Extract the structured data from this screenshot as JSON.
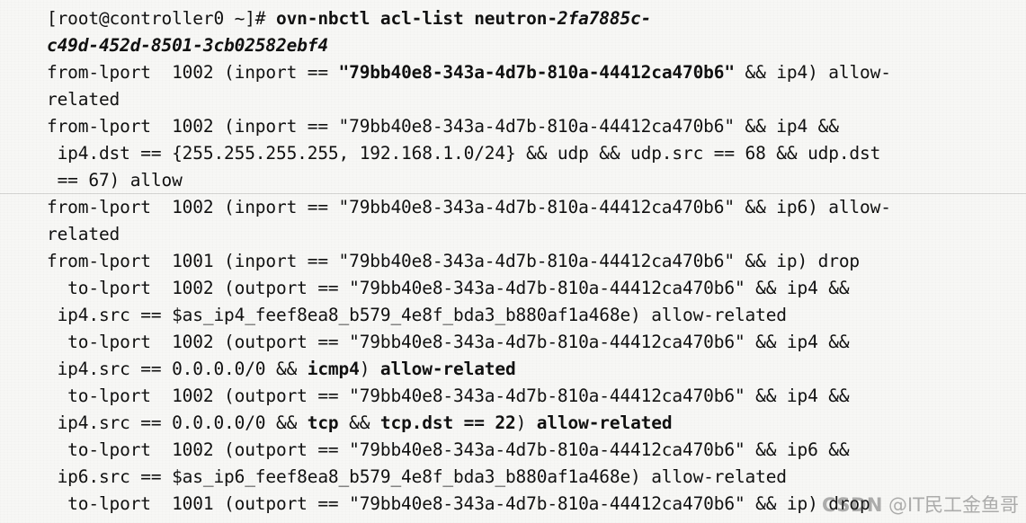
{
  "terminal": {
    "background_color": "#f7f7f5",
    "text_color": "#111111",
    "prompt": "[root@controller0 ~]# ",
    "command": "ovn-nbctl acl-list neutron-",
    "command_argument_line1": "2fa7885c-",
    "command_argument_line2": "c49d-452d-8501-3cb02582ebf4",
    "lines": [
      {
        "id": "line-prompt-command",
        "segments": [
          {
            "text": "[root@controller0 ~]# ",
            "style": "regular"
          },
          {
            "text": "ovn-nbctl acl-list neutron-",
            "style": "bold"
          },
          {
            "text": "2fa7885c-",
            "style": "bolditalic"
          }
        ]
      },
      {
        "id": "line-command-wrap",
        "segments": [
          {
            "text": "c49d-452d-8501-3cb02582ebf4",
            "style": "bolditalic"
          }
        ]
      },
      {
        "id": "line-acl-1a",
        "segments": [
          {
            "text": "from-lport  1002 (inport == ",
            "style": "regular"
          },
          {
            "text": "\"79bb40e8-343a-4d7b-810a-44412ca470b6\"",
            "style": "bold"
          },
          {
            "text": " && ip4) allow-",
            "style": "regular"
          }
        ]
      },
      {
        "id": "line-acl-1b",
        "segments": [
          {
            "text": "related",
            "style": "regular"
          }
        ]
      },
      {
        "id": "line-acl-2a",
        "segments": [
          {
            "text": "from-lport  1002 (inport == \"79bb40e8-343a-4d7b-810a-44412ca470b6\" && ip4 &&",
            "style": "regular"
          }
        ]
      },
      {
        "id": "line-acl-2b",
        "segments": [
          {
            "text": " ip4.dst == {255.255.255.255, 192.168.1.0/24} && udp && udp.src == 68 && udp.dst",
            "style": "regular"
          }
        ]
      },
      {
        "id": "line-acl-2c",
        "segments": [
          {
            "text": " == 67) allow",
            "style": "regular"
          }
        ]
      },
      {
        "id": "line-acl-3a",
        "segments": [
          {
            "text": "from-lport  1002 (inport == \"79bb40e8-343a-4d7b-810a-44412ca470b6\" && ip6) allow-",
            "style": "regular"
          }
        ]
      },
      {
        "id": "line-acl-3b",
        "segments": [
          {
            "text": "related",
            "style": "regular"
          }
        ]
      },
      {
        "id": "line-acl-4",
        "segments": [
          {
            "text": "from-lport  1001 (inport == \"79bb40e8-343a-4d7b-810a-44412ca470b6\" && ip) drop",
            "style": "regular"
          }
        ]
      },
      {
        "id": "line-acl-5a",
        "segments": [
          {
            "text": "  to-lport  1002 (outport == \"79bb40e8-343a-4d7b-810a-44412ca470b6\" && ip4 &&",
            "style": "regular"
          }
        ]
      },
      {
        "id": "line-acl-5b",
        "segments": [
          {
            "text": " ip4.src == $as_ip4_feef8ea8_b579_4e8f_bda3_b880af1a468e) allow-related",
            "style": "regular"
          }
        ]
      },
      {
        "id": "line-acl-6a",
        "segments": [
          {
            "text": "  to-lport  1002 (outport == \"79bb40e8-343a-4d7b-810a-44412ca470b6\" && ip4 &&",
            "style": "regular"
          }
        ]
      },
      {
        "id": "line-acl-6b",
        "segments": [
          {
            "text": " ip4.src == 0.0.0.0/0 && ",
            "style": "regular"
          },
          {
            "text": "icmp4",
            "style": "bold"
          },
          {
            "text": ")",
            "style": "regular"
          },
          {
            "text": " allow-related",
            "style": "bold"
          }
        ]
      },
      {
        "id": "line-acl-7a",
        "segments": [
          {
            "text": "  to-lport  1002 (outport == \"79bb40e8-343a-4d7b-810a-44412ca470b6\" && ip4 &&",
            "style": "regular"
          }
        ]
      },
      {
        "id": "line-acl-7b",
        "segments": [
          {
            "text": " ip4.src == 0.0.0.0/0 && ",
            "style": "regular"
          },
          {
            "text": "tcp",
            "style": "bold"
          },
          {
            "text": " && ",
            "style": "regular"
          },
          {
            "text": "tcp.dst == 22",
            "style": "bold"
          },
          {
            "text": ")",
            "style": "regular"
          },
          {
            "text": " allow-related",
            "style": "bold"
          }
        ]
      },
      {
        "id": "line-acl-8a",
        "segments": [
          {
            "text": "  to-lport  1002 (outport == \"79bb40e8-343a-4d7b-810a-44412ca470b6\" && ip6 &&",
            "style": "regular"
          }
        ]
      },
      {
        "id": "line-acl-8b",
        "segments": [
          {
            "text": " ip6.src == $as_ip6_feef8ea8_b579_4e8f_bda3_b880af1a468e) allow-related",
            "style": "regular"
          }
        ]
      },
      {
        "id": "line-acl-9",
        "segments": [
          {
            "text": "  to-lport  1001 (outport == \"79bb40e8-343a-4d7b-810a-44412ca470b6\" && ip) drop",
            "style": "regular"
          }
        ]
      }
    ]
  },
  "watermark": {
    "brand": "CSDN",
    "handle": "@IT民工金鱼哥",
    "color": "#464646"
  }
}
